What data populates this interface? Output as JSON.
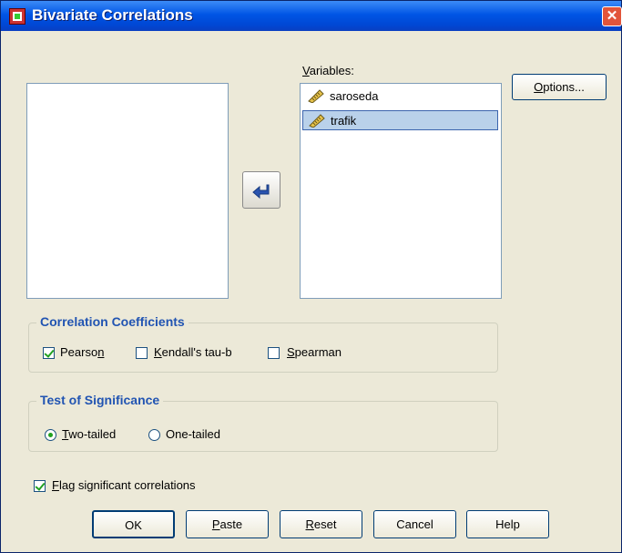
{
  "window": {
    "title": "Bivariate Correlations",
    "close_glyph": "✕"
  },
  "variables": {
    "label_prefix": "",
    "label_underlined": "V",
    "label_rest": "ariables:",
    "items": [
      {
        "name": "saroseda",
        "icon": "scale-ruler-icon",
        "selected": false
      },
      {
        "name": "trafik",
        "icon": "scale-ruler-icon",
        "selected": true
      }
    ]
  },
  "buttons": {
    "options_u": "O",
    "options_rest": "ptions...",
    "ok": "OK",
    "paste_u": "P",
    "paste_rest": "aste",
    "reset_u": "R",
    "reset_rest": "eset",
    "cancel": "Cancel",
    "help": "Help"
  },
  "correlation": {
    "title": "Correlation Coefficients",
    "pearson_pre": "Pearso",
    "pearson_u": "n",
    "pearson_checked": true,
    "kendall_u": "K",
    "kendall_rest": "endall's tau-b",
    "kendall_checked": false,
    "spearman_u": "S",
    "spearman_rest": "pearman",
    "spearman_checked": false
  },
  "significance": {
    "title": "Test of Significance",
    "two_u": "T",
    "two_rest": "wo-tailed",
    "two_selected": true,
    "one": "One-tailed",
    "one_selected": false
  },
  "flag": {
    "u": "F",
    "rest": "lag significant correlations",
    "checked": true
  },
  "colors": {
    "titlebar": "#0055e5",
    "group_title": "#2154b2",
    "check_mark": "#21a121",
    "selection": "#b9d1ea"
  }
}
